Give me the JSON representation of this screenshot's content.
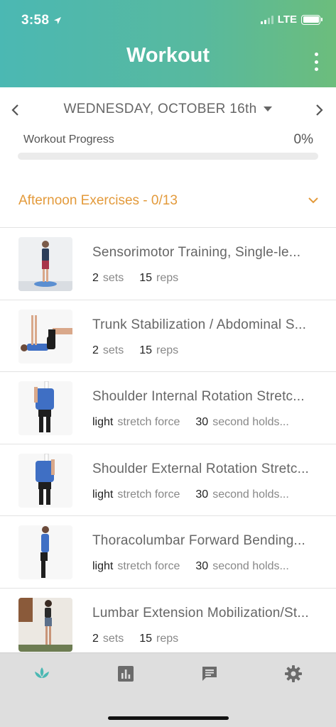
{
  "status_bar": {
    "time": "3:58",
    "network": "LTE"
  },
  "header": {
    "title": "Workout"
  },
  "date_nav": {
    "date": "WEDNESDAY, OCTOBER 16th"
  },
  "progress": {
    "label": "Workout Progress",
    "percent_text": "0%",
    "fraction": 0
  },
  "section": {
    "title": "Afternoon Exercises - 0/13"
  },
  "exercises": [
    {
      "name": "Sensorimotor Training,  Single-le...",
      "v1": "2",
      "u1": "sets",
      "v2": "15",
      "u2": "reps"
    },
    {
      "name": "Trunk Stabilization / Abdominal S...",
      "v1": "2",
      "u1": "sets",
      "v2": "15",
      "u2": "reps"
    },
    {
      "name": "Shoulder Internal Rotation Stretc...",
      "v1": "light",
      "u1": "stretch force",
      "v2": "30",
      "u2": "second holds..."
    },
    {
      "name": "Shoulder External Rotation Stretc...",
      "v1": "light",
      "u1": "stretch force",
      "v2": "30",
      "u2": "second holds..."
    },
    {
      "name": "Thoracolumbar Forward Bending...",
      "v1": "light",
      "u1": "stretch force",
      "v2": "30",
      "u2": "second holds..."
    },
    {
      "name": "Lumbar Extension Mobilization/St...",
      "v1": "2",
      "u1": "sets",
      "v2": "15",
      "u2": "reps"
    }
  ],
  "colors": {
    "accent": "#4bb8b3",
    "section_title": "#e39a3b",
    "header_gradient_end": "#6cbd7c"
  },
  "tab_icons": [
    "lotus-icon",
    "bar-chart-icon",
    "chat-icon",
    "gear-icon"
  ]
}
